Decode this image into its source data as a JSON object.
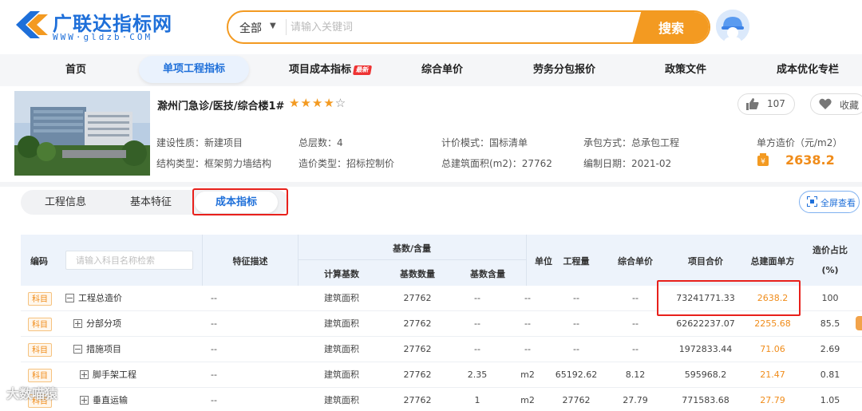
{
  "header": {
    "logo_text": "广联达指标网",
    "logo_sub": "WWW·gldzb·COM",
    "search_scope": "全部",
    "search_placeholder": "请输入关键词",
    "search_button": "搜索"
  },
  "nav": {
    "items": [
      "首页",
      "单项工程指标",
      "项目成本指标",
      "综合单价",
      "劳务分包报价",
      "政策文件",
      "成本优化专栏"
    ],
    "hot_badge": "最新",
    "active_index": 1
  },
  "project": {
    "title": "滁州门急诊/医技/综合楼1#",
    "rating": 4,
    "likes": "107",
    "favorite_label": "收藏",
    "info": [
      [
        "建设性质：新建项目",
        "总层数：4",
        "计价模式：国标清单",
        "承包方式：总承包工程"
      ],
      [
        "结构类型：框架剪力墙结构",
        "造价类型：招标控制价",
        "总建筑面积(m2)：27762",
        "编制日期：2021-02"
      ]
    ],
    "unit_price_label": "单方造价（元/m2）",
    "unit_price_value": "2638.2"
  },
  "tabs": {
    "items": [
      "工程信息",
      "基本特征",
      "成本指标"
    ],
    "active_index": 2,
    "fullscreen_label": "全屏查看"
  },
  "table": {
    "headers": {
      "code": "编码",
      "filter_placeholder": "请输入科目名称检索",
      "feature": "特征描述",
      "base_group": "基数/含量",
      "calc_base": "计算基数",
      "base_qty": "基数数量",
      "base_content": "基数含量",
      "unit": "单位",
      "quantity": "工程量",
      "unit_price": "综合单价",
      "total": "项目合价",
      "area_price": "总建面单方",
      "ratio": "造价占比",
      "ratio_unit": "(%)"
    },
    "rows": [
      {
        "badge": "科目",
        "tree": "minus",
        "indent": 0,
        "name": "工程总造价",
        "feature": "--",
        "calc_base": "建筑面积",
        "base_qty": "27762",
        "base_content": "--",
        "unit": "--",
        "quantity": "--",
        "unit_price": "--",
        "total": "73241771.33",
        "area_price": "2638.2",
        "ratio": "100"
      },
      {
        "badge": "科目",
        "tree": "plus",
        "indent": 1,
        "name": "分部分项",
        "feature": "--",
        "calc_base": "建筑面积",
        "base_qty": "27762",
        "base_content": "--",
        "unit": "--",
        "quantity": "--",
        "unit_price": "--",
        "total": "62622237.07",
        "area_price": "2255.68",
        "ratio": "85.5"
      },
      {
        "badge": "科目",
        "tree": "minus",
        "indent": 1,
        "name": "措施项目",
        "feature": "--",
        "calc_base": "建筑面积",
        "base_qty": "27762",
        "base_content": "--",
        "unit": "--",
        "quantity": "--",
        "unit_price": "--",
        "total": "1972833.44",
        "area_price": "71.06",
        "ratio": "2.69"
      },
      {
        "badge": "科目",
        "tree": "plus",
        "indent": 2,
        "name": "脚手架工程",
        "feature": "--",
        "calc_base": "建筑面积",
        "base_qty": "27762",
        "base_content": "2.35",
        "unit": "m2",
        "quantity": "65192.62",
        "unit_price": "8.12",
        "total": "595968.2",
        "area_price": "21.47",
        "ratio": "0.81"
      },
      {
        "badge": "科目",
        "tree": "plus",
        "indent": 2,
        "name": "垂直运输",
        "feature": "--",
        "calc_base": "建筑面积",
        "base_qty": "27762",
        "base_content": "1",
        "unit": "m2",
        "quantity": "27762",
        "unit_price": "27.79",
        "total": "771583.68",
        "area_price": "27.79",
        "ratio": "1.05"
      }
    ]
  },
  "watermark": "大数喵猿",
  "colors": {
    "brand_blue": "#1e6fd9",
    "accent_orange": "#f39a21",
    "highlight_red": "#e8201b"
  }
}
